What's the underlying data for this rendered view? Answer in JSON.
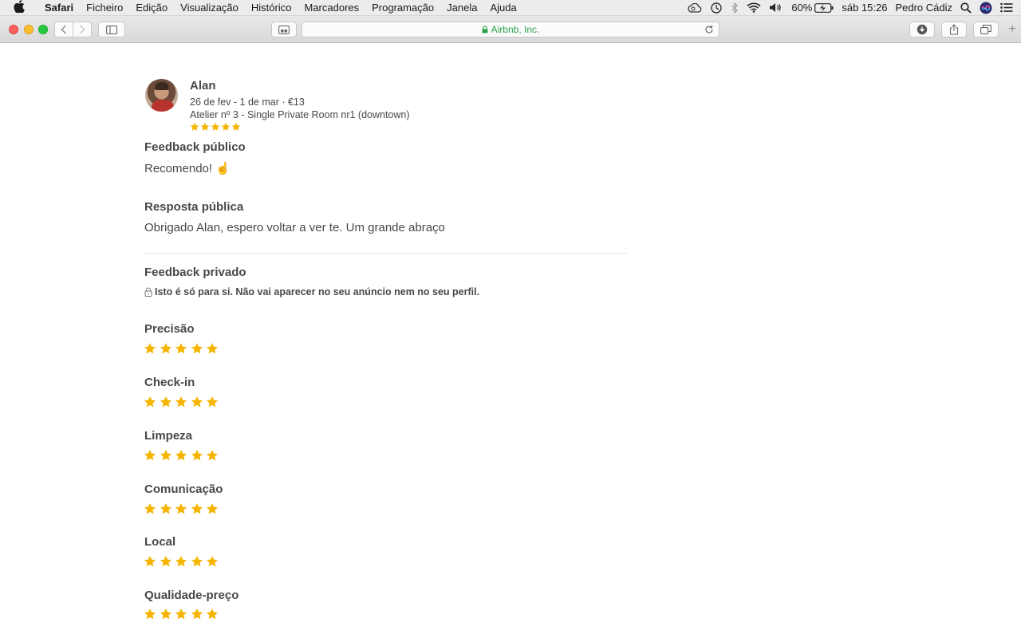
{
  "menubar": {
    "app": "Safari",
    "items": [
      "Ficheiro",
      "Edição",
      "Visualização",
      "Histórico",
      "Marcadores",
      "Programação",
      "Janela",
      "Ajuda"
    ],
    "battery": "60%",
    "clock": "sáb 15:26",
    "user": "Pedro Cádiz"
  },
  "browser": {
    "url": "Airbnb, Inc."
  },
  "review": {
    "guest_name": "Alan",
    "dates": "26 de fev - 1 de mar · €13",
    "listing": "Atelier nº 3 - Single Private Room nr1 (downtown)",
    "overall_rating": 5,
    "public_feedback_title": "Feedback público",
    "public_feedback_text": "Recomendo! ☝️",
    "public_response_title": "Resposta pública",
    "public_response_text": "Obrigado Alan, espero voltar a ver te. Um grande abraço",
    "private_feedback_title": "Feedback privado",
    "private_feedback_note": "Isto é só para si. Não vai aparecer no seu anúncio nem no seu perfil."
  },
  "ratings": [
    {
      "label": "Precisão",
      "value": 5
    },
    {
      "label": "Check-in",
      "value": 5
    },
    {
      "label": "Limpeza",
      "value": 5
    },
    {
      "label": "Comunicação",
      "value": 5
    },
    {
      "label": "Local",
      "value": 5
    },
    {
      "label": "Qualidade-preço",
      "value": 5
    }
  ],
  "colors": {
    "star": "#f5b400",
    "secure_url": "#2aa34a",
    "text": "#484848"
  }
}
